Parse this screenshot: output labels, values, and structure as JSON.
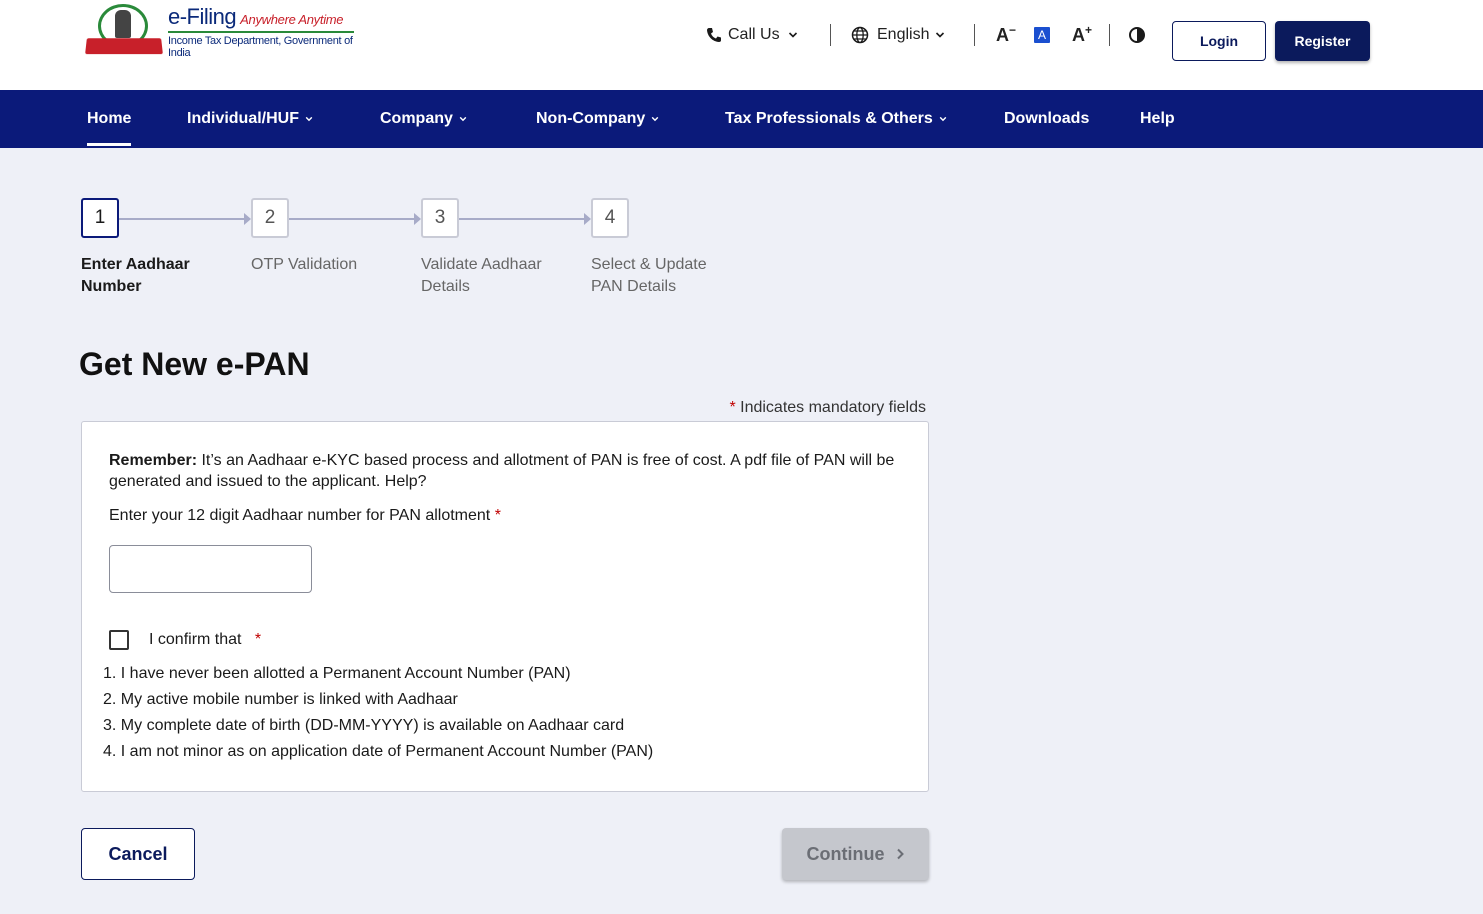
{
  "header": {
    "brand_main": "e-Filing",
    "brand_tagline": "Anywhere Anytime",
    "brand_sub": "Income Tax Department, Government of India",
    "call_us": "Call Us",
    "language": "English",
    "font_decrease": "A",
    "font_default": "A",
    "font_increase": "A",
    "login": "Login",
    "register": "Register"
  },
  "nav": {
    "items": [
      {
        "label": "Home"
      },
      {
        "label": "Individual/HUF"
      },
      {
        "label": "Company"
      },
      {
        "label": "Non-Company"
      },
      {
        "label": "Tax Professionals & Others"
      },
      {
        "label": "Downloads"
      },
      {
        "label": "Help"
      }
    ]
  },
  "stepper": {
    "steps": [
      {
        "number": "1",
        "label": "Enter Aadhaar Number"
      },
      {
        "number": "2",
        "label": "OTP Validation"
      },
      {
        "number": "3",
        "label": "Validate Aadhaar Details"
      },
      {
        "number": "4",
        "label": "Select & Update PAN Details"
      }
    ]
  },
  "form": {
    "title": "Get New e-PAN",
    "mandatory_star": "*",
    "mandatory_note": " Indicates mandatory fields",
    "remember_label": "Remember:",
    "remember_text": " It’s an Aadhaar e-KYC based process and allotment of PAN is free of cost. A pdf file of PAN will be generated and issued to the applicant. Help?",
    "aadhaar_label": "Enter your 12 digit Aadhaar number for PAN allotment",
    "aadhaar_value": "",
    "required_star": "*",
    "confirm_label": "I confirm that",
    "confirm_items": [
      "1. I have never been allotted a Permanent Account Number (PAN)",
      "2. My active mobile number is linked with Aadhaar",
      "3. My complete date of birth (DD-MM-YYYY) is available on Aadhaar card",
      "4. I am not minor as on application date of Permanent Account Number (PAN)"
    ],
    "cancel": "Cancel",
    "continue": "Continue"
  },
  "colors": {
    "nav_bg": "#0b1a7a",
    "primary": "#0b1a5c",
    "required": "#c00000",
    "page_bg": "#eef0f7"
  }
}
